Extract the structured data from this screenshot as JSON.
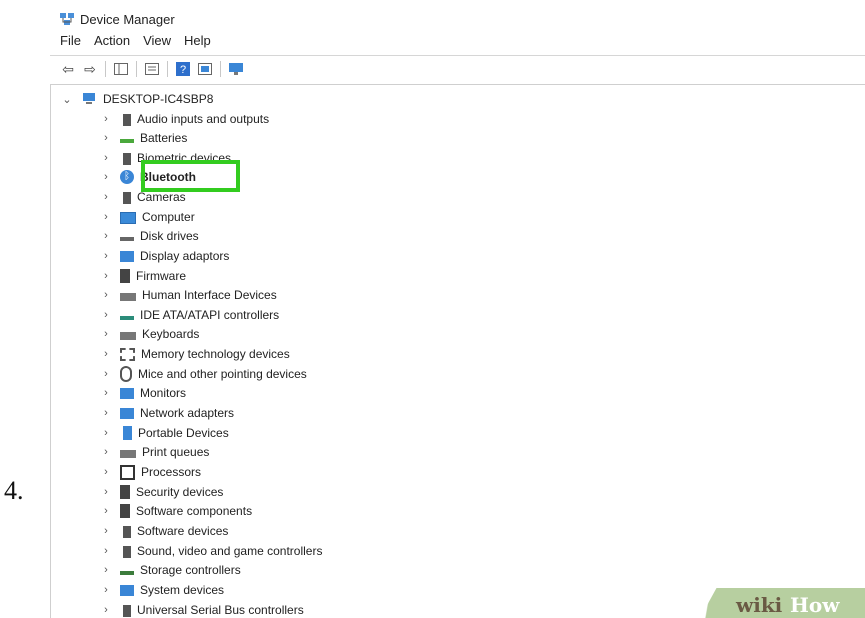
{
  "step_label": "4.",
  "window": {
    "title": "Device Manager",
    "menu": [
      "File",
      "Action",
      "View",
      "Help"
    ],
    "root": "DESKTOP-IC4SBP8",
    "highlighted_item": "Bluetooth",
    "highlight_color": "#33cc1f",
    "items": [
      {
        "label": "Audio inputs and outputs",
        "icon": "speaker-icon"
      },
      {
        "label": "Batteries",
        "icon": "battery-icon"
      },
      {
        "label": "Biometric devices",
        "icon": "fingerprint-icon"
      },
      {
        "label": "Bluetooth",
        "icon": "bluetooth-icon"
      },
      {
        "label": "Cameras",
        "icon": "camera-icon"
      },
      {
        "label": "Computer",
        "icon": "computer-icon"
      },
      {
        "label": "Disk drives",
        "icon": "disk-icon"
      },
      {
        "label": "Display adaptors",
        "icon": "display-icon"
      },
      {
        "label": "Firmware",
        "icon": "firmware-icon"
      },
      {
        "label": "Human Interface Devices",
        "icon": "hid-icon"
      },
      {
        "label": "IDE ATA/ATAPI controllers",
        "icon": "ide-icon"
      },
      {
        "label": "Keyboards",
        "icon": "keyboard-icon"
      },
      {
        "label": "Memory technology devices",
        "icon": "memory-icon"
      },
      {
        "label": "Mice and other pointing devices",
        "icon": "mouse-icon"
      },
      {
        "label": "Monitors",
        "icon": "monitor-icon"
      },
      {
        "label": "Network adapters",
        "icon": "network-icon"
      },
      {
        "label": "Portable Devices",
        "icon": "portable-icon"
      },
      {
        "label": "Print queues",
        "icon": "printer-icon"
      },
      {
        "label": "Processors",
        "icon": "processor-icon"
      },
      {
        "label": "Security devices",
        "icon": "security-icon"
      },
      {
        "label": "Software components",
        "icon": "software-component-icon"
      },
      {
        "label": "Software devices",
        "icon": "software-device-icon"
      },
      {
        "label": "Sound, video and game controllers",
        "icon": "sound-icon"
      },
      {
        "label": "Storage controllers",
        "icon": "storage-icon"
      },
      {
        "label": "System devices",
        "icon": "system-icon"
      },
      {
        "label": "Universal Serial Bus controllers",
        "icon": "usb-icon"
      }
    ]
  },
  "watermark": {
    "wiki": "wiki",
    "how": "How"
  }
}
